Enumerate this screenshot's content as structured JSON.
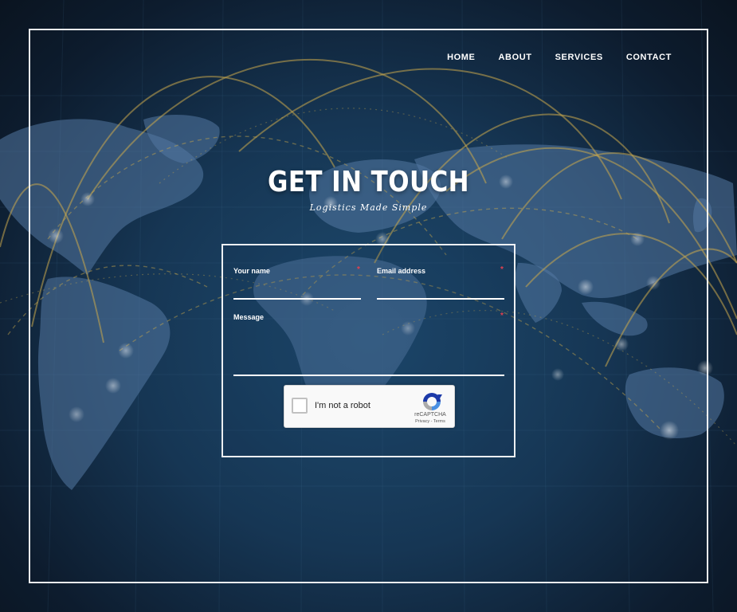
{
  "nav": {
    "items": [
      {
        "label": "HOME"
      },
      {
        "label": "ABOUT"
      },
      {
        "label": "SERVICES"
      },
      {
        "label": "CONTACT"
      }
    ]
  },
  "hero": {
    "title": "GET IN TOUCH",
    "subtitle": "Logistics Made Simple"
  },
  "form": {
    "name_label": "Your name",
    "name_value": "",
    "email_label": "Email address",
    "email_value": "",
    "message_label": "Message",
    "message_value": "",
    "required_marker": "*",
    "captcha": {
      "label": "I'm not a robot",
      "brand": "reCAPTCHA",
      "privacy": "Privacy",
      "separator": " - ",
      "terms": "Terms"
    }
  },
  "colors": {
    "required": "#e04050",
    "arc": "#c9a84c",
    "background": "#163654"
  },
  "icons": {
    "captcha": "recaptcha-icon",
    "background": "world-map-icon"
  }
}
